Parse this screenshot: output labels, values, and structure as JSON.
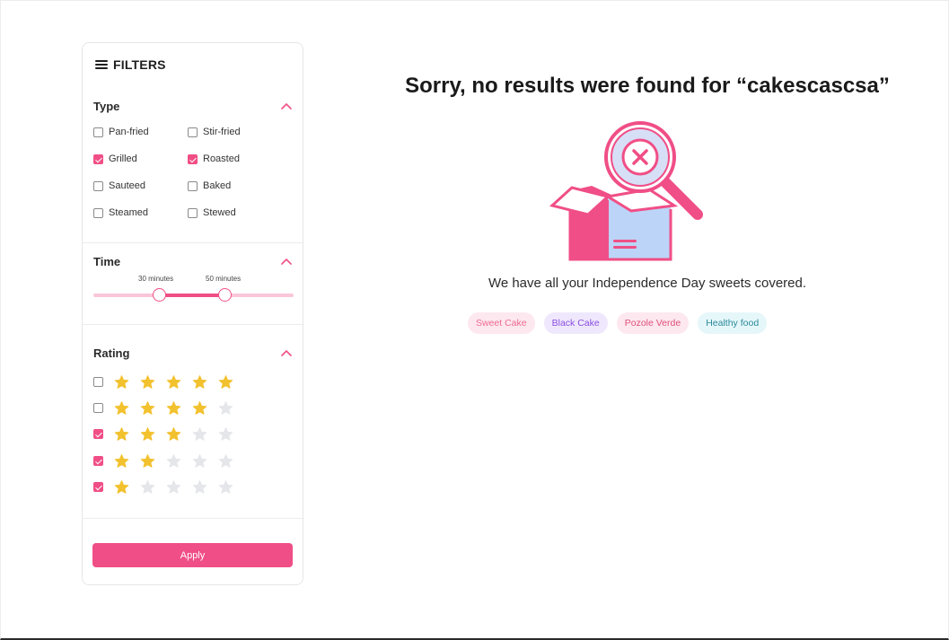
{
  "sidebar": {
    "title": "FILTERS",
    "type_section": {
      "title": "Type",
      "options": [
        {
          "label": "Pan-fried",
          "checked": false
        },
        {
          "label": "Stir-fried",
          "checked": false
        },
        {
          "label": "Grilled",
          "checked": true
        },
        {
          "label": "Roasted",
          "checked": true
        },
        {
          "label": "Sauteed",
          "checked": false
        },
        {
          "label": "Baked",
          "checked": false
        },
        {
          "label": "Steamed",
          "checked": false
        },
        {
          "label": "Stewed",
          "checked": false
        }
      ]
    },
    "time_section": {
      "title": "Time",
      "min_label": "30 minutes",
      "max_label": "50 minutes"
    },
    "rating_section": {
      "title": "Rating",
      "rows": [
        {
          "stars": 5,
          "checked": false
        },
        {
          "stars": 4,
          "checked": false
        },
        {
          "stars": 3,
          "checked": true
        },
        {
          "stars": 2,
          "checked": true
        },
        {
          "stars": 1,
          "checked": true
        }
      ]
    },
    "apply_label": "Apply"
  },
  "main": {
    "headline": "Sorry, no results were found for “cakescascsa”",
    "subtitle": "We have all your Independence Day sweets covered.",
    "chips": [
      {
        "label": "Sweet Cake",
        "bg": "#fde8ef",
        "color": "#f06a93"
      },
      {
        "label": "Black Cake",
        "bg": "#efe8fd",
        "color": "#8a4de0"
      },
      {
        "label": "Pozole Verde",
        "bg": "#fde8ef",
        "color": "#e0507d"
      },
      {
        "label": "Healthy food",
        "bg": "#e6f7fa",
        "color": "#2a8a9a"
      }
    ]
  },
  "colors": {
    "accent": "#f04e86",
    "star_on": "#f2c12e",
    "star_off": "#e4e6ea"
  }
}
